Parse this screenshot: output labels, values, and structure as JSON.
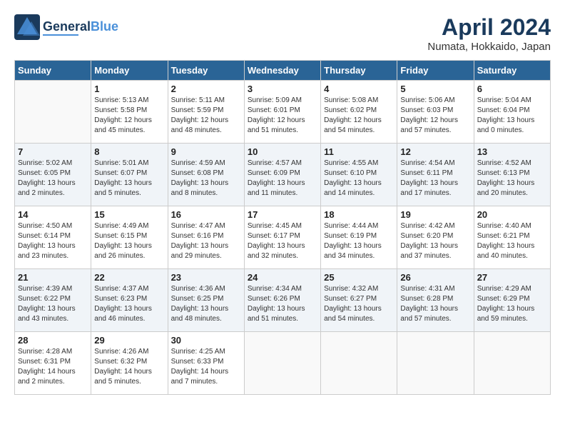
{
  "header": {
    "logo_line1": "General",
    "logo_line2": "Blue",
    "title": "April 2024",
    "location": "Numata, Hokkaido, Japan"
  },
  "weekdays": [
    "Sunday",
    "Monday",
    "Tuesday",
    "Wednesday",
    "Thursday",
    "Friday",
    "Saturday"
  ],
  "weeks": [
    [
      {
        "day": "",
        "info": ""
      },
      {
        "day": "1",
        "info": "Sunrise: 5:13 AM\nSunset: 5:58 PM\nDaylight: 12 hours\nand 45 minutes."
      },
      {
        "day": "2",
        "info": "Sunrise: 5:11 AM\nSunset: 5:59 PM\nDaylight: 12 hours\nand 48 minutes."
      },
      {
        "day": "3",
        "info": "Sunrise: 5:09 AM\nSunset: 6:01 PM\nDaylight: 12 hours\nand 51 minutes."
      },
      {
        "day": "4",
        "info": "Sunrise: 5:08 AM\nSunset: 6:02 PM\nDaylight: 12 hours\nand 54 minutes."
      },
      {
        "day": "5",
        "info": "Sunrise: 5:06 AM\nSunset: 6:03 PM\nDaylight: 12 hours\nand 57 minutes."
      },
      {
        "day": "6",
        "info": "Sunrise: 5:04 AM\nSunset: 6:04 PM\nDaylight: 13 hours\nand 0 minutes."
      }
    ],
    [
      {
        "day": "7",
        "info": "Sunrise: 5:02 AM\nSunset: 6:05 PM\nDaylight: 13 hours\nand 2 minutes."
      },
      {
        "day": "8",
        "info": "Sunrise: 5:01 AM\nSunset: 6:07 PM\nDaylight: 13 hours\nand 5 minutes."
      },
      {
        "day": "9",
        "info": "Sunrise: 4:59 AM\nSunset: 6:08 PM\nDaylight: 13 hours\nand 8 minutes."
      },
      {
        "day": "10",
        "info": "Sunrise: 4:57 AM\nSunset: 6:09 PM\nDaylight: 13 hours\nand 11 minutes."
      },
      {
        "day": "11",
        "info": "Sunrise: 4:55 AM\nSunset: 6:10 PM\nDaylight: 13 hours\nand 14 minutes."
      },
      {
        "day": "12",
        "info": "Sunrise: 4:54 AM\nSunset: 6:11 PM\nDaylight: 13 hours\nand 17 minutes."
      },
      {
        "day": "13",
        "info": "Sunrise: 4:52 AM\nSunset: 6:13 PM\nDaylight: 13 hours\nand 20 minutes."
      }
    ],
    [
      {
        "day": "14",
        "info": "Sunrise: 4:50 AM\nSunset: 6:14 PM\nDaylight: 13 hours\nand 23 minutes."
      },
      {
        "day": "15",
        "info": "Sunrise: 4:49 AM\nSunset: 6:15 PM\nDaylight: 13 hours\nand 26 minutes."
      },
      {
        "day": "16",
        "info": "Sunrise: 4:47 AM\nSunset: 6:16 PM\nDaylight: 13 hours\nand 29 minutes."
      },
      {
        "day": "17",
        "info": "Sunrise: 4:45 AM\nSunset: 6:17 PM\nDaylight: 13 hours\nand 32 minutes."
      },
      {
        "day": "18",
        "info": "Sunrise: 4:44 AM\nSunset: 6:19 PM\nDaylight: 13 hours\nand 34 minutes."
      },
      {
        "day": "19",
        "info": "Sunrise: 4:42 AM\nSunset: 6:20 PM\nDaylight: 13 hours\nand 37 minutes."
      },
      {
        "day": "20",
        "info": "Sunrise: 4:40 AM\nSunset: 6:21 PM\nDaylight: 13 hours\nand 40 minutes."
      }
    ],
    [
      {
        "day": "21",
        "info": "Sunrise: 4:39 AM\nSunset: 6:22 PM\nDaylight: 13 hours\nand 43 minutes."
      },
      {
        "day": "22",
        "info": "Sunrise: 4:37 AM\nSunset: 6:23 PM\nDaylight: 13 hours\nand 46 minutes."
      },
      {
        "day": "23",
        "info": "Sunrise: 4:36 AM\nSunset: 6:25 PM\nDaylight: 13 hours\nand 48 minutes."
      },
      {
        "day": "24",
        "info": "Sunrise: 4:34 AM\nSunset: 6:26 PM\nDaylight: 13 hours\nand 51 minutes."
      },
      {
        "day": "25",
        "info": "Sunrise: 4:32 AM\nSunset: 6:27 PM\nDaylight: 13 hours\nand 54 minutes."
      },
      {
        "day": "26",
        "info": "Sunrise: 4:31 AM\nSunset: 6:28 PM\nDaylight: 13 hours\nand 57 minutes."
      },
      {
        "day": "27",
        "info": "Sunrise: 4:29 AM\nSunset: 6:29 PM\nDaylight: 13 hours\nand 59 minutes."
      }
    ],
    [
      {
        "day": "28",
        "info": "Sunrise: 4:28 AM\nSunset: 6:31 PM\nDaylight: 14 hours\nand 2 minutes."
      },
      {
        "day": "29",
        "info": "Sunrise: 4:26 AM\nSunset: 6:32 PM\nDaylight: 14 hours\nand 5 minutes."
      },
      {
        "day": "30",
        "info": "Sunrise: 4:25 AM\nSunset: 6:33 PM\nDaylight: 14 hours\nand 7 minutes."
      },
      {
        "day": "",
        "info": ""
      },
      {
        "day": "",
        "info": ""
      },
      {
        "day": "",
        "info": ""
      },
      {
        "day": "",
        "info": ""
      }
    ]
  ]
}
